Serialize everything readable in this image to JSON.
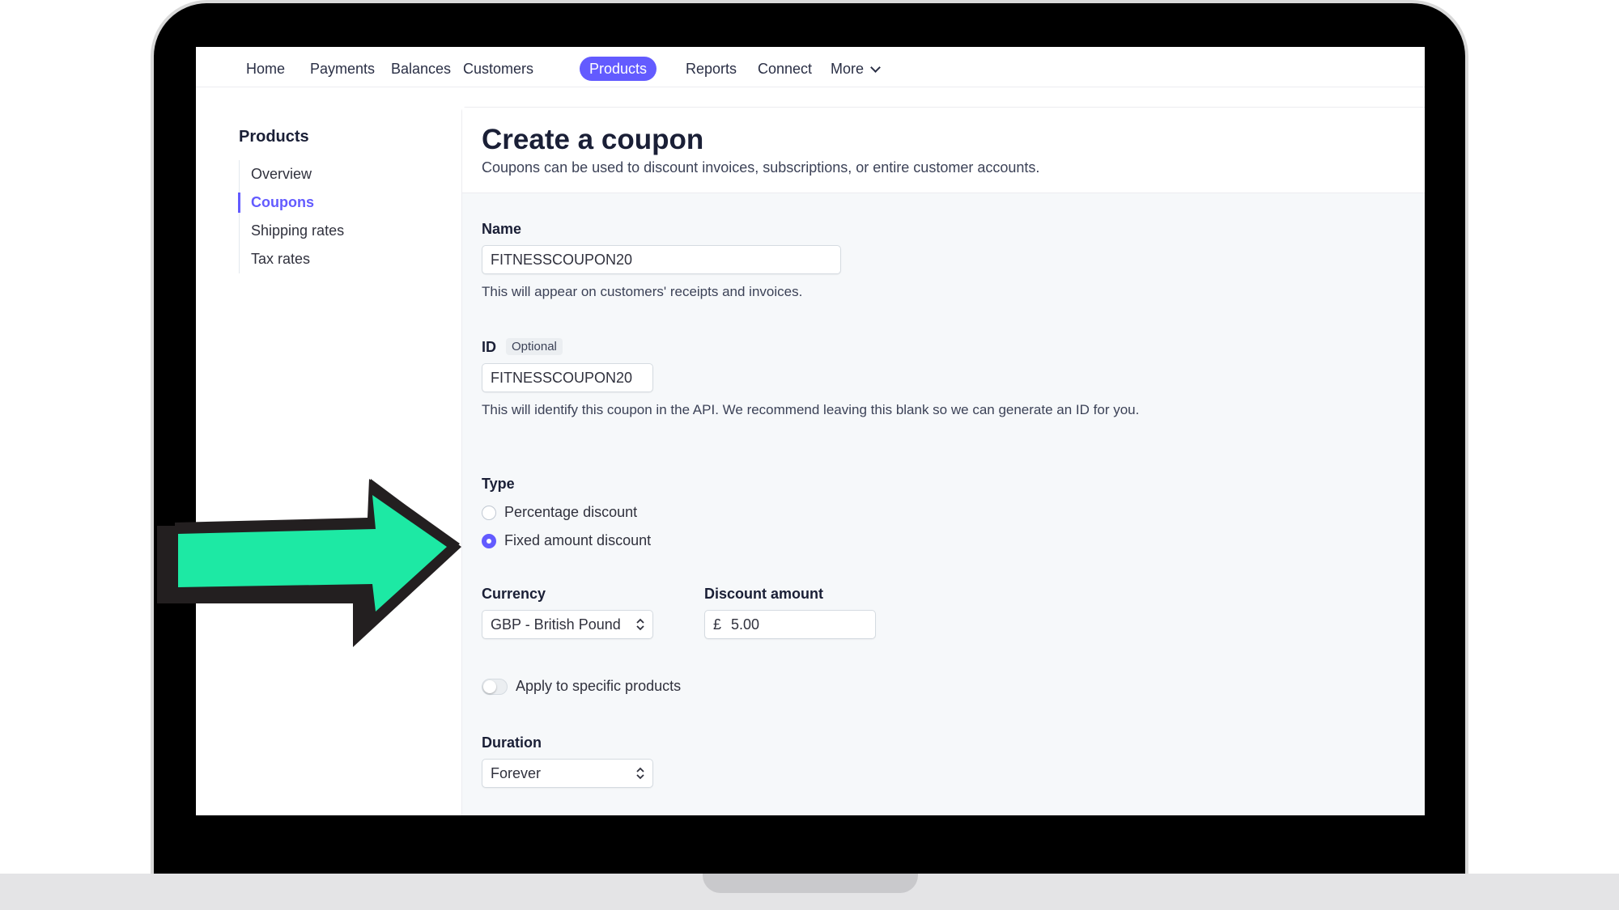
{
  "nav": {
    "items": [
      "Home",
      "Payments",
      "Balances",
      "Customers",
      "Products",
      "Reports",
      "Connect"
    ],
    "active": "Products",
    "more_label": "More"
  },
  "sidebar": {
    "title": "Products",
    "items": [
      "Overview",
      "Coupons",
      "Shipping rates",
      "Tax rates"
    ],
    "active": "Coupons"
  },
  "page": {
    "title": "Create a coupon",
    "subtitle": "Coupons can be used to discount invoices, subscriptions, or entire customer accounts."
  },
  "form": {
    "name_label": "Name",
    "name_value": "FITNESSCOUPON20",
    "name_help": "This will appear on customers' receipts and invoices.",
    "id_label": "ID",
    "id_badge": "Optional",
    "id_value": "FITNESSCOUPON20",
    "id_help": "This will identify this coupon in the API. We recommend leaving this blank so we can generate an ID for you.",
    "type_label": "Type",
    "type_options": [
      "Percentage discount",
      "Fixed amount discount"
    ],
    "type_selected": "Fixed amount discount",
    "currency_label": "Currency",
    "currency_value": "GBP - British Pound",
    "discount_label": "Discount amount",
    "discount_symbol": "£",
    "discount_value": "5.00",
    "apply_products_label": "Apply to specific products",
    "apply_products_on": false,
    "duration_label": "Duration",
    "duration_value": "Forever"
  },
  "colors": {
    "accent": "#635bff",
    "arrow_fill": "#1de9a4",
    "arrow_outline": "#231f20"
  }
}
